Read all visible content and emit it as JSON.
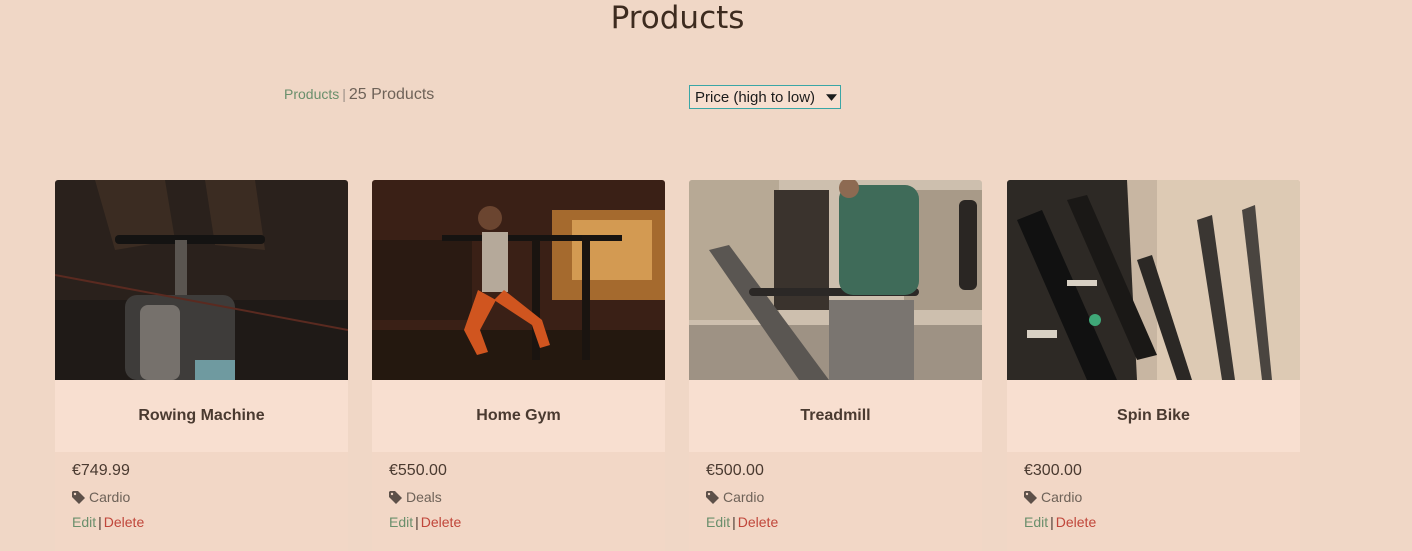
{
  "page": {
    "title": "Products"
  },
  "toolbar": {
    "breadcrumb": "Products",
    "separator": "|",
    "count": "25 Products",
    "sort_value": "Price (high to low)"
  },
  "products": [
    {
      "name": "Rowing Machine",
      "price": "€749.99",
      "category": "Cardio",
      "edit": "Edit",
      "delete": "Delete"
    },
    {
      "name": "Home Gym",
      "price": "€550.00",
      "category": "Deals",
      "edit": "Edit",
      "delete": "Delete"
    },
    {
      "name": "Treadmill",
      "price": "€500.00",
      "category": "Cardio",
      "edit": "Edit",
      "delete": "Delete"
    },
    {
      "name": "Spin Bike",
      "price": "€300.00",
      "category": "Cardio",
      "edit": "Edit",
      "delete": "Delete"
    }
  ],
  "icons": {
    "category": "tag-icon",
    "sort": "chevron-down-icon"
  },
  "colors": {
    "background": "#f0d7c6",
    "edit_link": "#6a8f6c",
    "delete_link": "#c0463a",
    "select_border": "#3aa6a6"
  }
}
